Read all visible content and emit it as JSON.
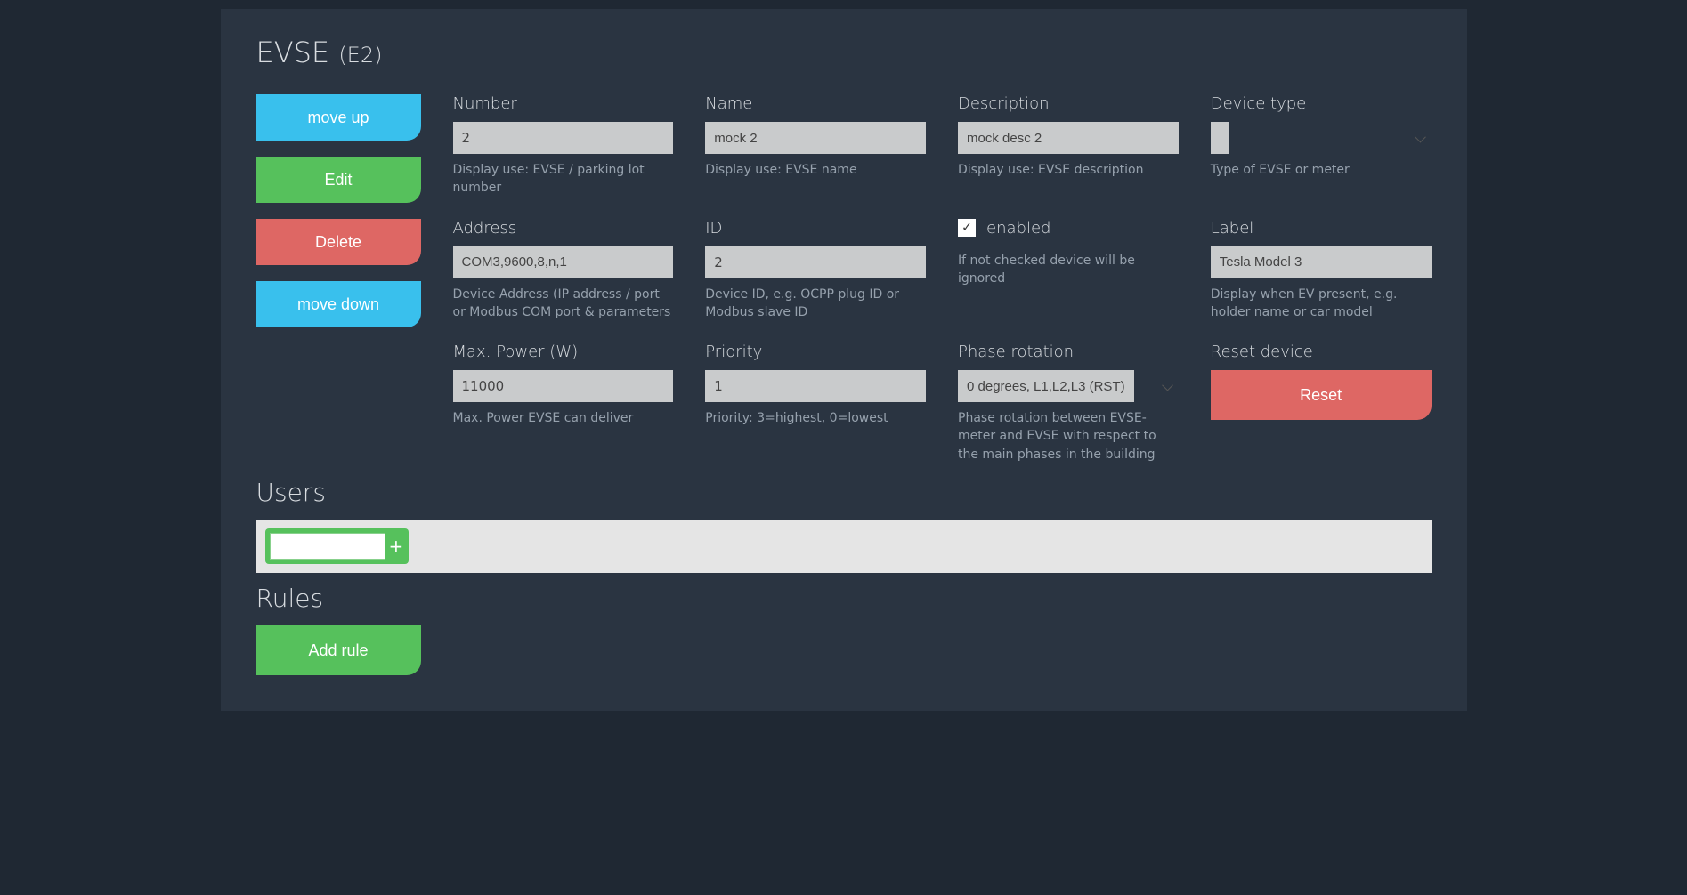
{
  "header": {
    "title": "EVSE",
    "sub": "(E2)"
  },
  "sidebar": {
    "move_up": "move up",
    "edit": "Edit",
    "delete": "Delete",
    "move_down": "move down"
  },
  "fields": {
    "number": {
      "label": "Number",
      "value": "2",
      "help": "Display use: EVSE / parking lot number"
    },
    "name": {
      "label": "Name",
      "value": "mock 2",
      "help": "Display use: EVSE name"
    },
    "description": {
      "label": "Description",
      "value": "mock desc 2",
      "help": "Display use: EVSE description"
    },
    "device_type": {
      "label": "Device type",
      "value": "",
      "help": "Type of EVSE or meter"
    },
    "address": {
      "label": "Address",
      "value": "COM3,9600,8,n,1",
      "help": "Device Address (IP address / port or Modbus COM port & parameters"
    },
    "id": {
      "label": "ID",
      "value": "2",
      "help": "Device ID, e.g. OCPP plug ID or Modbus slave ID"
    },
    "enabled": {
      "label": "enabled",
      "checked": true,
      "help": "If not checked device will be ignored"
    },
    "label_field": {
      "label": "Label",
      "value": "Tesla Model 3",
      "help": "Display when EV present, e.g. holder name or car model"
    },
    "max_power": {
      "label": "Max. Power (W)",
      "value": "11000",
      "help": "Max. Power EVSE can deliver"
    },
    "priority": {
      "label": "Priority",
      "value": "1",
      "help": "Priority: 3=highest, 0=lowest"
    },
    "phase_rotation": {
      "label": "Phase rotation",
      "value": "0 degrees, L1,L2,L3 (RST)",
      "help": "Phase rotation between EVSE-meter and EVSE with respect to the main phases in the building"
    },
    "reset": {
      "label": "Reset device",
      "button": "Reset"
    }
  },
  "users": {
    "title": "Users",
    "add_placeholder": ""
  },
  "rules": {
    "title": "Rules",
    "add": "Add rule"
  }
}
